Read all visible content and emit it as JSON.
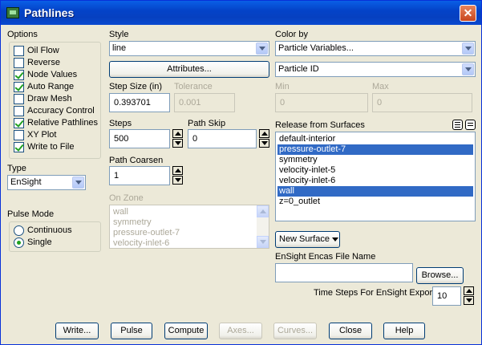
{
  "window": {
    "title": "Pathlines",
    "close": "✕"
  },
  "options": {
    "label": "Options",
    "items": [
      {
        "label": "Oil Flow",
        "checked": false
      },
      {
        "label": "Reverse",
        "checked": false
      },
      {
        "label": "Node Values",
        "checked": true
      },
      {
        "label": "Auto Range",
        "checked": true
      },
      {
        "label": "Draw Mesh",
        "checked": false
      },
      {
        "label": "Accuracy Control",
        "checked": false
      },
      {
        "label": "Relative Pathlines",
        "checked": true
      },
      {
        "label": "XY Plot",
        "checked": false
      },
      {
        "label": "Write to File",
        "checked": true
      }
    ]
  },
  "type": {
    "label": "Type",
    "value": "EnSight"
  },
  "pulse_mode": {
    "label": "Pulse Mode",
    "options": [
      {
        "label": "Continuous",
        "selected": false
      },
      {
        "label": "Single",
        "selected": true
      }
    ]
  },
  "style": {
    "label": "Style",
    "value": "line",
    "attributes_button": "Attributes..."
  },
  "step_size": {
    "label": "Step Size  (in)",
    "value": "0.393701"
  },
  "tolerance": {
    "label": "Tolerance",
    "value": "0.001"
  },
  "steps": {
    "label": "Steps",
    "value": "500"
  },
  "path_skip": {
    "label": "Path Skip",
    "value": "0"
  },
  "path_coarsen": {
    "label": "Path Coarsen",
    "value": "1"
  },
  "on_zone": {
    "label": "On Zone",
    "items": [
      "wall",
      "symmetry",
      "pressure-outlet-7",
      "velocity-inlet-6"
    ]
  },
  "color_by": {
    "label": "Color by",
    "category": "Particle Variables...",
    "variable": "Particle ID"
  },
  "min": {
    "label": "Min",
    "value": "0"
  },
  "max": {
    "label": "Max",
    "value": "0"
  },
  "release": {
    "label": "Release from Surfaces",
    "items": [
      {
        "label": "default-interior",
        "selected": false
      },
      {
        "label": "pressure-outlet-7",
        "selected": true
      },
      {
        "label": "symmetry",
        "selected": false
      },
      {
        "label": "velocity-inlet-5",
        "selected": false
      },
      {
        "label": "velocity-inlet-6",
        "selected": false
      },
      {
        "label": "wall",
        "selected": true
      },
      {
        "label": "z=0_outlet",
        "selected": false
      }
    ],
    "new_surface": "New Surface"
  },
  "ensight": {
    "file_label": "EnSight Encas File Name",
    "file_value": "",
    "browse": "Browse...",
    "time_steps_label": "Time Steps For EnSight Export",
    "time_steps_value": "10"
  },
  "buttons": {
    "write": "Write...",
    "pulse": "Pulse",
    "compute": "Compute",
    "axes": "Axes...",
    "curves": "Curves...",
    "close": "Close",
    "help": "Help"
  }
}
